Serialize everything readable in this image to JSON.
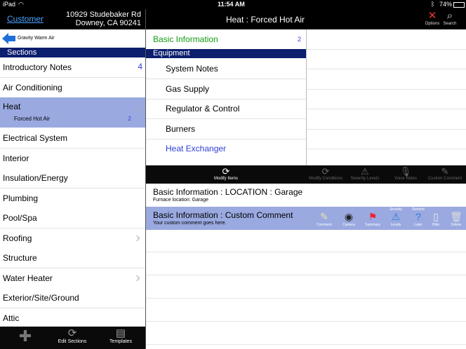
{
  "status_bar": {
    "device": "iPad",
    "time": "11:54 AM",
    "battery": "74%"
  },
  "left_header": {
    "customer_link": "Customer",
    "address_line1": "10929 Studebaker Rd",
    "address_line2": "Downey, CA 90241"
  },
  "right_header": {
    "title": "Heat : Forced Hot Air",
    "options_label": "Options",
    "search_label": "Search"
  },
  "back": {
    "label": "Gravity Warm Air"
  },
  "sections": {
    "header": "Sections",
    "items": [
      {
        "label": "Introductory Notes",
        "count": "4"
      },
      {
        "label": "Air Conditioning"
      },
      {
        "label": "Heat",
        "sub": "Forced Hot Air",
        "sub_count": "2"
      },
      {
        "label": "Electrical System"
      },
      {
        "label": "Interior"
      },
      {
        "label": "Insulation/Energy"
      },
      {
        "label": "Plumbing"
      },
      {
        "label": "Pool/Spa"
      },
      {
        "label": "Roofing"
      },
      {
        "label": "Structure"
      },
      {
        "label": "Water Heater"
      },
      {
        "label": "Exterior/Site/Ground"
      },
      {
        "label": "Attic"
      }
    ]
  },
  "left_footer": {
    "edit_sections": "Edit Sections",
    "templates": "Templates"
  },
  "middle": {
    "basic_info": {
      "label": "Basic Information",
      "count": "2"
    },
    "equipment_header": "Equipment",
    "equipment_items": [
      "System Notes",
      "Gas Supply",
      "Regulator & Control",
      "Burners",
      "Heat Exchanger"
    ]
  },
  "toolbar": {
    "modify_items": "Modify Items",
    "modify_conditions": "Modify Conditions",
    "severity_levels": "Severity Levels",
    "voice_notes": "Voice Notes",
    "custom_comment": "Custom Comment"
  },
  "comments": [
    {
      "title": "Basic Information : LOCATION : Garage",
      "subtitle": "Furnace location: Garage"
    },
    {
      "title": "Basic Information : Custom Comment",
      "subtitle": "Your custom comment goes here."
    }
  ],
  "comment_actions": {
    "comment": "Comment",
    "camera": "Camera",
    "summary": "Summary",
    "levels_top": "Severity",
    "levels": "Levels",
    "later_top": "Remind",
    "later": "Later",
    "hide": "Hide",
    "delete": "Delete"
  },
  "colors": {
    "selected_row": "#9aa9e0",
    "section_header": "#0c1e6e",
    "link_blue": "#4aa3ff",
    "basic_info_green": "#129a12"
  }
}
